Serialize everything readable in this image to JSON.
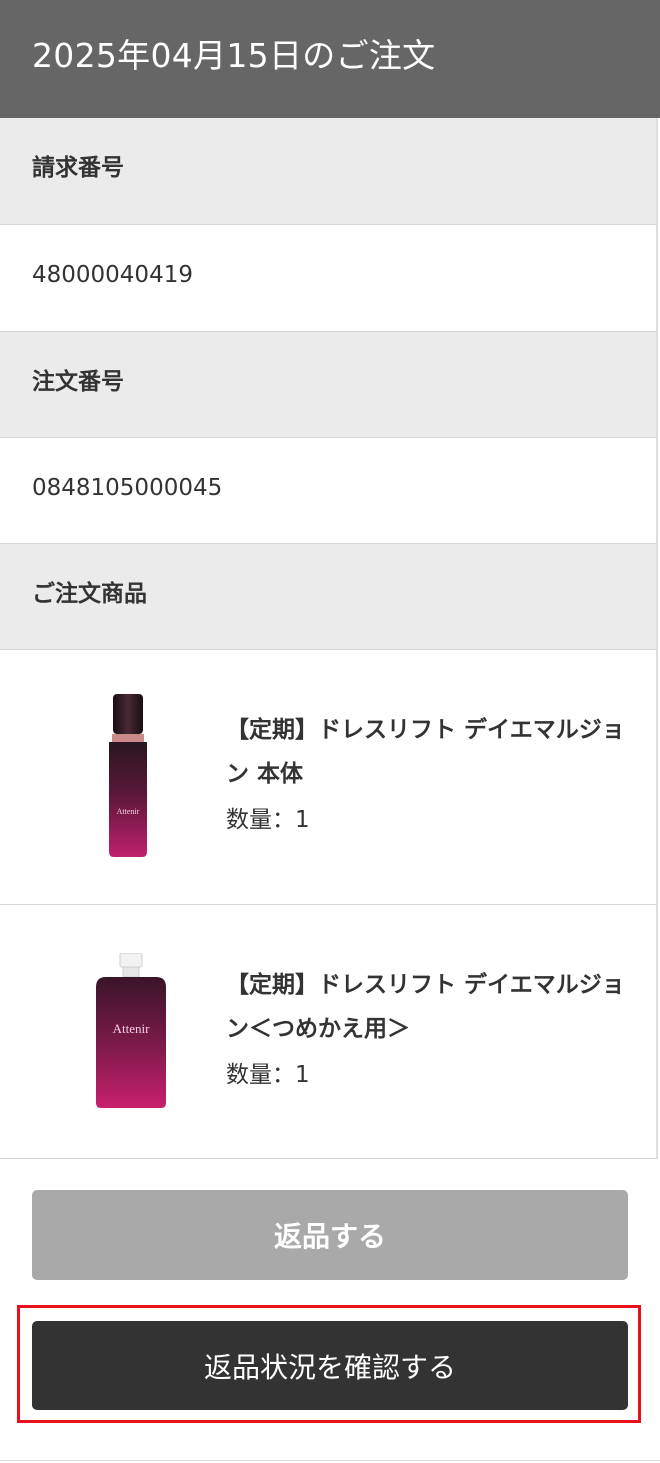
{
  "header": {
    "title": "2025年04月15日のご注文"
  },
  "billing": {
    "label": "請求番号",
    "value": "48000040419"
  },
  "order": {
    "label": "注文番号",
    "value": "0848105000045"
  },
  "products": {
    "label": "ご注文商品",
    "items": [
      {
        "name": "【定期】ドレスリフト デイエマルジョン 本体",
        "quantity": "数量：1",
        "image_icon": "emulsion-bottle-icon",
        "brand_text": "Attenir"
      },
      {
        "name": "【定期】ドレスリフト デイエマルジョン＜つめかえ用＞",
        "quantity": "数量：1",
        "image_icon": "refill-pouch-icon",
        "brand_text": "Attenir"
      }
    ]
  },
  "actions": {
    "return_label": "返品する",
    "status_label": "返品状況を確認する"
  },
  "colors": {
    "header_bg": "#666666",
    "label_bg": "#ebebeb",
    "return_button": "#a9a9a9",
    "status_button": "#333333",
    "highlight": "#e8101a",
    "product_accent": "#a0185a"
  }
}
